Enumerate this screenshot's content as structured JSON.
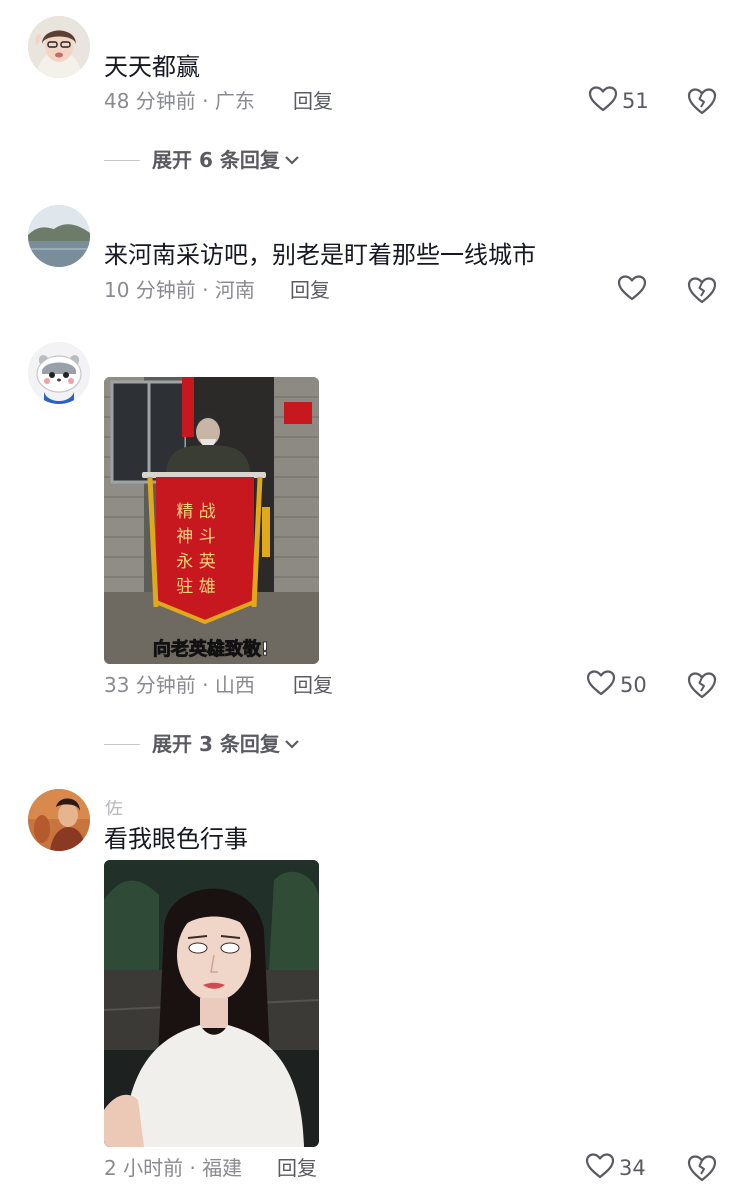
{
  "comments": [
    {
      "username": "",
      "text": "天天都赢",
      "time": "48 分钟前",
      "separator": "·",
      "location": "广东",
      "reply_label": "回复",
      "likes": "51",
      "expand_label": "展开 6 条回复"
    },
    {
      "username": "",
      "text": "来河南采访吧，别老是盯着那些一线城市",
      "time": "10 分钟前",
      "separator": "·",
      "location": "河南",
      "reply_label": "回复",
      "likes": ""
    },
    {
      "username": "",
      "image": {
        "banner_lines": [
          "精 战",
          "神 斗",
          "永 英",
          "驻 雄"
        ],
        "caption": "向老英雄致敬!"
      },
      "time": "33 分钟前",
      "separator": "·",
      "location": "山西",
      "reply_label": "回复",
      "likes": "50",
      "expand_label": "展开 3 条回复"
    },
    {
      "username": "佐",
      "text": "看我眼色行事",
      "time": "2 小时前",
      "separator": "·",
      "location": "福建",
      "reply_label": "回复",
      "likes": "34"
    }
  ],
  "icons": {
    "like": "heart-outline-icon",
    "dislike": "broken-heart-icon",
    "expand": "chevron-down-icon"
  },
  "colors": {
    "text": "#161823",
    "meta": "#8a8b91",
    "banner": "#c8181f",
    "banner_text": "#f5d27a"
  }
}
